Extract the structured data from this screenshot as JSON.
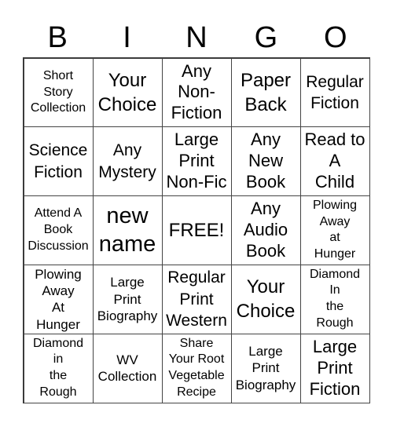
{
  "header": {
    "letters": [
      "B",
      "I",
      "N",
      "G",
      "O"
    ]
  },
  "cells": [
    [
      "Short\nStory\nCollection",
      "Your\nChoice",
      "Any\nNon-\nFiction",
      "Paper\nBack",
      "Regular\nFiction"
    ],
    [
      "Science\nFiction",
      "Any\nMystery",
      "Large\nPrint\nNon-Fic",
      "Any\nNew\nBook",
      "Read to\nA\nChild"
    ],
    [
      "Attend A\nBook\nDiscussion",
      "new\nname",
      "FREE!",
      "Any\nAudio\nBook",
      "Plowing\nAway\nat\nHunger"
    ],
    [
      "Plowing\nAway\nAt\nHunger",
      "Large\nPrint\nBiography",
      "Regular\nPrint\nWestern",
      "Your\nChoice",
      "Diamond\nIn\nthe\nRough"
    ],
    [
      "Diamond\nin\nthe\nRough",
      "WV\nCollection",
      "Share\nYour Root\nVegetable\nRecipe",
      "Large\nPrint\nBiography",
      "Large\nPrint\nFiction"
    ]
  ]
}
